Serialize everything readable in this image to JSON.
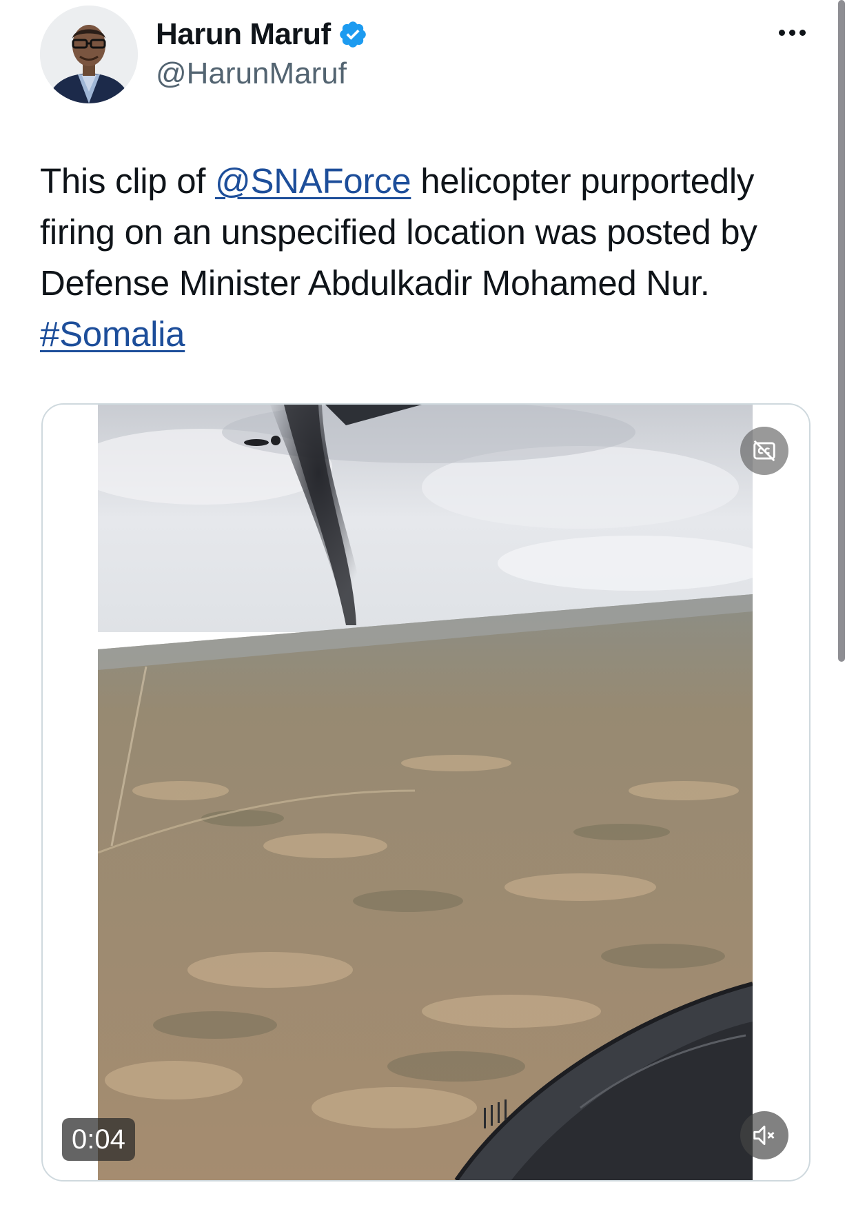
{
  "author": {
    "name": "Harun Maruf",
    "handle": "@HarunMaruf"
  },
  "tweet": {
    "text_before_mention": "This clip of ",
    "mention": "@SNAForce",
    "text_after_mention": " helicopter purportedly firing on an unspecified location was posted by Defense Minister Abdulkadir Mohamed Nur. ",
    "hashtag": "#Somalia"
  },
  "video": {
    "timestamp": "0:04"
  },
  "icons": {
    "verified": "verified-badge-icon",
    "more": "more-options-icon",
    "captions": "captions-off-icon",
    "mute": "muted-speaker-icon"
  },
  "colors": {
    "link": "#1d4e9a",
    "verified": "#1d9bf0",
    "secondary_text": "#536471"
  }
}
